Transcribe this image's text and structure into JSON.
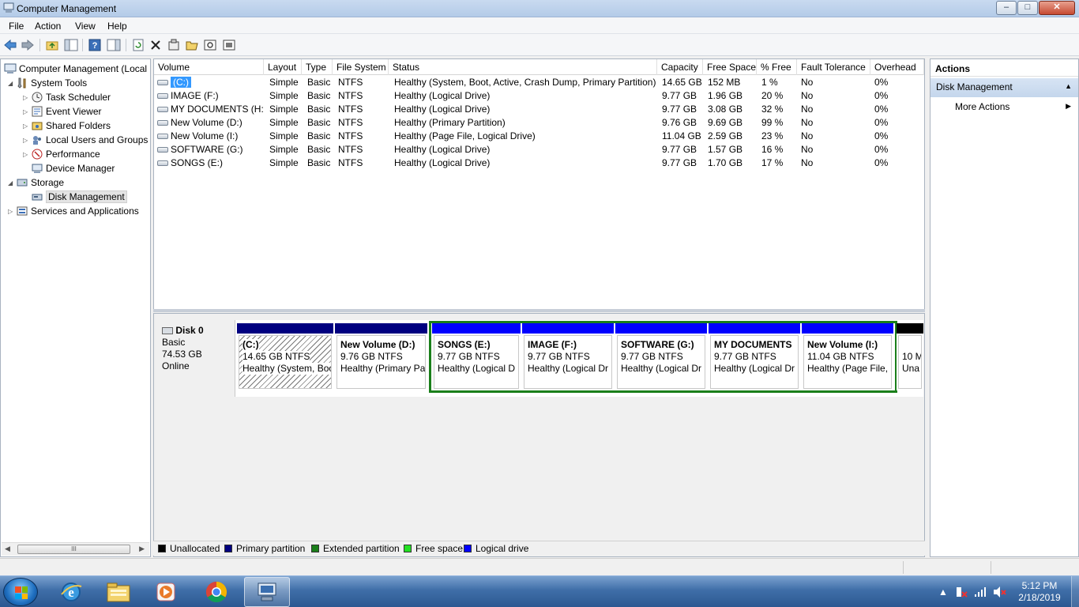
{
  "window": {
    "title": "Computer Management",
    "min": "–",
    "max": "□",
    "close": "✕"
  },
  "menu": [
    "File",
    "Action",
    "View",
    "Help"
  ],
  "toolbar": [
    "back-arrow-icon",
    "forward-arrow-icon",
    "up-folder-icon",
    "show-hide-tree-icon",
    "help-icon",
    "show-hide-action-pane-icon",
    "refresh-icon",
    "delete-icon",
    "properties-icon",
    "open-icon",
    "find-icon",
    "settings-icon"
  ],
  "tree": {
    "root": "Computer Management (Local",
    "system_tools": "System Tools",
    "task_scheduler": "Task Scheduler",
    "event_viewer": "Event Viewer",
    "shared_folders": "Shared Folders",
    "local_users": "Local Users and Groups",
    "performance": "Performance",
    "device_manager": "Device Manager",
    "storage": "Storage",
    "disk_management": "Disk Management",
    "services": "Services and Applications",
    "scroll_grip": "III"
  },
  "volumes": {
    "columns": [
      "Volume",
      "Layout",
      "Type",
      "File System",
      "Status",
      "Capacity",
      "Free Space",
      "% Free",
      "Fault Tolerance",
      "Overhead"
    ],
    "rows": [
      [
        "(C:)",
        "Simple",
        "Basic",
        "NTFS",
        "Healthy (System, Boot, Active, Crash Dump, Primary Partition)",
        "14.65 GB",
        "152 MB",
        "1 %",
        "No",
        "0%"
      ],
      [
        "IMAGE (F:)",
        "Simple",
        "Basic",
        "NTFS",
        "Healthy (Logical Drive)",
        "9.77 GB",
        "1.96 GB",
        "20 %",
        "No",
        "0%"
      ],
      [
        "MY DOCUMENTS (H:)",
        "Simple",
        "Basic",
        "NTFS",
        "Healthy (Logical Drive)",
        "9.77 GB",
        "3.08 GB",
        "32 %",
        "No",
        "0%"
      ],
      [
        "New Volume (D:)",
        "Simple",
        "Basic",
        "NTFS",
        "Healthy (Primary Partition)",
        "9.76 GB",
        "9.69 GB",
        "99 %",
        "No",
        "0%"
      ],
      [
        "New Volume (I:)",
        "Simple",
        "Basic",
        "NTFS",
        "Healthy (Page File, Logical Drive)",
        "11.04 GB",
        "2.59 GB",
        "23 %",
        "No",
        "0%"
      ],
      [
        "SOFTWARE (G:)",
        "Simple",
        "Basic",
        "NTFS",
        "Healthy (Logical Drive)",
        "9.77 GB",
        "1.57 GB",
        "16 %",
        "No",
        "0%"
      ],
      [
        "SONGS (E:)",
        "Simple",
        "Basic",
        "NTFS",
        "Healthy (Logical Drive)",
        "9.77 GB",
        "1.70 GB",
        "17 %",
        "No",
        "0%"
      ]
    ]
  },
  "disk": {
    "name": "Disk 0",
    "type": "Basic",
    "size": "74.53 GB",
    "state": "Online",
    "partitions": [
      {
        "name": "(C:)",
        "size": "14.65 GB NTFS",
        "status": "Healthy (System, Boo",
        "kind": "primary"
      },
      {
        "name": "New Volume  (D:)",
        "size": "9.76 GB NTFS",
        "status": "Healthy (Primary Pa",
        "kind": "primary"
      },
      {
        "name": "SONGS  (E:)",
        "size": "9.77 GB NTFS",
        "status": "Healthy (Logical D",
        "kind": "logical"
      },
      {
        "name": "IMAGE  (F:)",
        "size": "9.77 GB NTFS",
        "status": "Healthy (Logical Dr",
        "kind": "logical"
      },
      {
        "name": "SOFTWARE  (G:)",
        "size": "9.77 GB NTFS",
        "status": "Healthy (Logical Dr",
        "kind": "logical"
      },
      {
        "name": "MY DOCUMENTS",
        "size": "9.77 GB NTFS",
        "status": "Healthy (Logical Dr",
        "kind": "logical"
      },
      {
        "name": "New Volume  (I:)",
        "size": "11.04 GB NTFS",
        "status": "Healthy (Page File,",
        "kind": "logical"
      },
      {
        "name": "",
        "size": "10 M",
        "status": "Una",
        "kind": "unallocated"
      }
    ]
  },
  "legend": {
    "unallocated": "Unallocated",
    "primary": "Primary partition",
    "extended": "Extended partition",
    "free": "Free space",
    "logical": "Logical drive"
  },
  "colors": {
    "primary": "#000080",
    "logical": "#0000ff",
    "extended": "#1a7f1a",
    "free": "#22e022",
    "unallocated": "#000000",
    "selection": "#3399ff"
  },
  "actions": {
    "header": "Actions",
    "section": "Disk Management",
    "more": "More Actions"
  },
  "taskbar": {
    "apps": [
      "ie-icon",
      "explorer-icon",
      "media-player-icon",
      "chrome-icon",
      "computer-management-icon"
    ],
    "time": "5:12 PM",
    "date": "2/18/2019"
  }
}
